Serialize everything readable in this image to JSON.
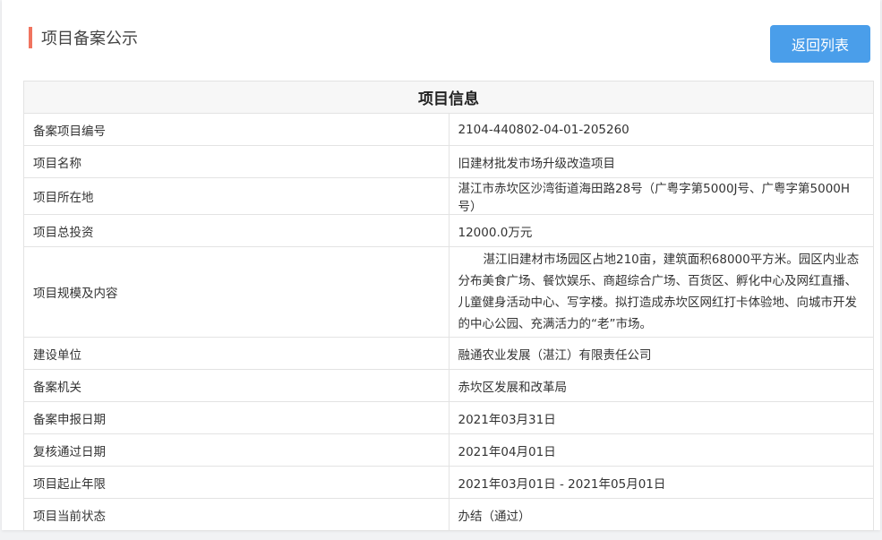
{
  "header": {
    "title": "项目备案公示",
    "back_label": "返回列表"
  },
  "table": {
    "heading": "项目信息",
    "rows": [
      {
        "label": "备案项目编号",
        "value": "2104-440802-04-01-205260"
      },
      {
        "label": "项目名称",
        "value": "旧建材批发市场升级改造项目"
      },
      {
        "label": "项目所在地",
        "value": "湛江市赤坎区沙湾街道海田路28号（广粤字第5000J号、广粤字第5000H号）"
      },
      {
        "label": "项目总投资",
        "value": "12000.0万元"
      },
      {
        "label": "项目规模及内容",
        "value": "湛江旧建材市场园区占地210亩，建筑面积68000平方米。园区内业态分布美食广场、餐饮娱乐、商超综合广场、百货区、孵化中心及网红直播、儿童健身活动中心、写字楼。拟打造成赤坎区网红打卡体验地、向城市开发的中心公园、充满活力的“老”市场。"
      },
      {
        "label": "建设单位",
        "value": "融通农业发展（湛江）有限责任公司"
      },
      {
        "label": "备案机关",
        "value": "赤坎区发展和改革局"
      },
      {
        "label": "备案申报日期",
        "value": "2021年03月31日"
      },
      {
        "label": "复核通过日期",
        "value": "2021年04月01日"
      },
      {
        "label": "项目起止年限",
        "value": "2021年03月01日 - 2021年05月01日"
      },
      {
        "label": "项目当前状态",
        "value": "办结（通过）"
      }
    ]
  },
  "colors": {
    "accent_mark": "#f0745f",
    "button_bg": "#4a9eea"
  }
}
